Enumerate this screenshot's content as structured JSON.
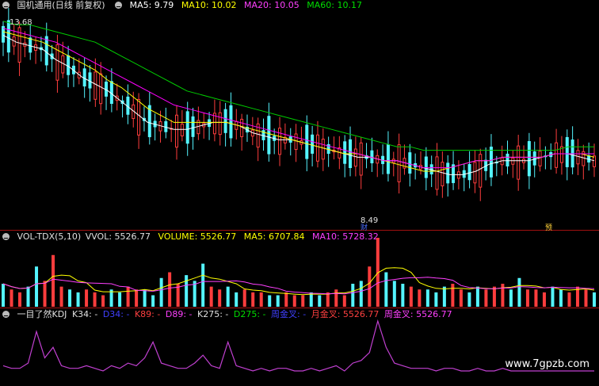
{
  "main_header": {
    "title": "国机通用(日线 前复权)",
    "ma5": "MA5: 9.79",
    "ma10": "MA10: 10.02",
    "ma20": "MA20: 10.05",
    "ma60": "MA60: 10.17"
  },
  "vol_header": {
    "name": "VOL-TDX(5,10)",
    "vvol": "VVOL: 5526.77",
    "volume": "VOLUME: 5526.77",
    "ma5": "MA5: 6707.84",
    "ma10": "MA10: 5728.32"
  },
  "kdj_header": {
    "name": "一目了然KDJ",
    "k34": "K34: -",
    "d34": "D34: -",
    "k89": "K89: -",
    "d89": "D89: -",
    "k275": "K275: -",
    "d275": "D275: -",
    "zhou_jincha": "周金叉: -",
    "yue_jincha": "月金叉: 5526.77",
    "zhou_jincha2": "周金叉: 5526.77"
  },
  "price_labels": {
    "high": "13.68",
    "low": "8.49",
    "marker_cai": "财",
    "marker_right": "预"
  },
  "watermark": "www.7gpzb.com",
  "colors": {
    "up": "#ff3d3d",
    "down": "#54f4ff",
    "ma5": "#ffffff",
    "ma10": "#ffff00",
    "ma20": "#ff00ff",
    "ma60": "#00cc00",
    "kdj": "#c040d0"
  },
  "chart_data": {
    "type": "candlestick",
    "series": [
      {
        "name": "MA5",
        "values": [
          13.4,
          13.2,
          13.1,
          13.0,
          12.7,
          12.5,
          12.2,
          12.0,
          11.8,
          11.5,
          11.2,
          10.9,
          10.8,
          10.7,
          10.7,
          10.8,
          10.9,
          10.9,
          10.8,
          10.6,
          10.5,
          10.4,
          10.4,
          10.3,
          10.2,
          10.1,
          10.0,
          9.9,
          9.9,
          9.8,
          9.8,
          9.7,
          9.6,
          9.5,
          9.4,
          9.4,
          9.5,
          9.7,
          9.8,
          9.8,
          9.8,
          9.9,
          10.0,
          10.0,
          9.9,
          9.8
        ]
      },
      {
        "name": "MA10",
        "values": [
          13.5,
          13.4,
          13.3,
          13.2,
          13.0,
          12.8,
          12.6,
          12.4,
          12.1,
          11.9,
          11.6,
          11.3,
          11.1,
          10.9,
          10.9,
          10.9,
          10.9,
          10.9,
          10.8,
          10.7,
          10.6,
          10.5,
          10.4,
          10.3,
          10.2,
          10.1,
          10.0,
          10.0,
          9.9,
          9.8,
          9.7,
          9.6,
          9.5,
          9.5,
          9.6,
          9.7,
          9.8,
          9.8,
          9.9,
          9.9,
          9.9,
          9.9,
          10.0,
          10.0,
          10.0,
          9.9
        ]
      },
      {
        "name": "MA20",
        "values": [
          13.6,
          13.5,
          13.4,
          13.3,
          13.2,
          13.0,
          12.8,
          12.6,
          12.4,
          12.2,
          12.0,
          11.8,
          11.6,
          11.4,
          11.3,
          11.2,
          11.1,
          11.0,
          10.9,
          10.8,
          10.7,
          10.6,
          10.5,
          10.4,
          10.3,
          10.2,
          10.1,
          10.0,
          9.9,
          9.8,
          9.8,
          9.7,
          9.6,
          9.6,
          9.6,
          9.7,
          9.8,
          9.8,
          9.9,
          9.9,
          9.9,
          9.9,
          10.0,
          10.0,
          10.0,
          10.0
        ]
      },
      {
        "name": "MA60",
        "values": [
          13.8,
          13.7,
          13.7,
          13.6,
          13.5,
          13.4,
          13.3,
          13.2,
          13.0,
          12.8,
          12.6,
          12.4,
          12.2,
          12.0,
          11.8,
          11.7,
          11.6,
          11.5,
          11.4,
          11.3,
          11.2,
          11.1,
          11.0,
          10.9,
          10.8,
          10.7,
          10.6,
          10.5,
          10.4,
          10.3,
          10.2,
          10.2,
          10.1,
          10.1,
          10.1,
          10.1,
          10.1,
          10.1,
          10.1,
          10.1,
          10.1,
          10.1,
          10.1,
          10.2,
          10.2,
          10.2
        ]
      }
    ],
    "volume": {
      "name": "VOLUME",
      "values": [
        8,
        6,
        5,
        7,
        14,
        9,
        18,
        7,
        6,
        5,
        6,
        5,
        4,
        6,
        5,
        7,
        6,
        6,
        4,
        10,
        12,
        8,
        11,
        9,
        15,
        7,
        6,
        7,
        5,
        6,
        5,
        5,
        4,
        4,
        5,
        4,
        4,
        5,
        4,
        5,
        6,
        4,
        8,
        9,
        14,
        24,
        12,
        9,
        8,
        7,
        6,
        6,
        5,
        7,
        8,
        6,
        5,
        7,
        6,
        7,
        8,
        6,
        10,
        6,
        6,
        5,
        7,
        6,
        5,
        7,
        6,
        5
      ]
    },
    "kdj": {
      "name": "KDJ",
      "values": [
        5,
        4,
        4,
        6,
        18,
        8,
        12,
        5,
        4,
        4,
        5,
        4,
        3,
        5,
        4,
        6,
        5,
        8,
        14,
        6,
        5,
        4,
        4,
        6,
        9,
        5,
        4,
        14,
        5,
        4,
        3,
        4,
        3,
        4,
        4,
        3,
        3,
        4,
        3,
        4,
        5,
        3,
        6,
        7,
        10,
        22,
        12,
        6,
        5,
        4,
        4,
        4,
        3,
        4,
        4,
        3,
        3,
        4,
        3,
        3,
        4,
        3,
        3,
        3,
        3,
        3,
        3,
        3,
        3,
        3,
        3,
        3
      ]
    },
    "ylim_price": [
      8.0,
      14.0
    ],
    "xlabel": "",
    "ylabel": ""
  }
}
